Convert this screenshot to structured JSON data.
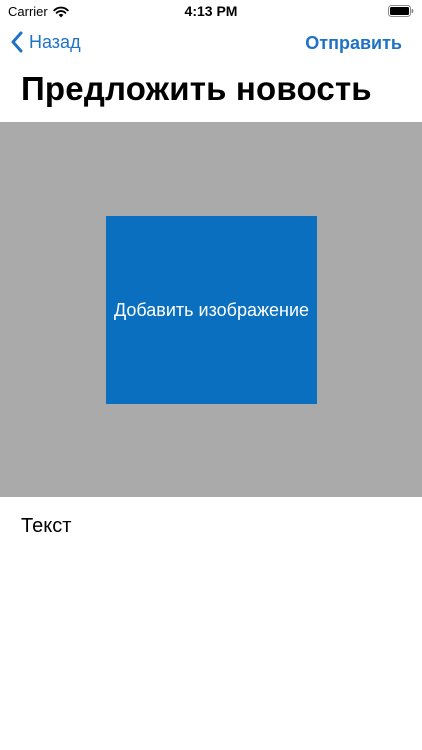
{
  "status_bar": {
    "carrier": "Carrier",
    "time": "4:13 PM",
    "wifi_icon": "wifi-icon",
    "battery_icon": "battery-icon"
  },
  "nav": {
    "back_label": "Назад",
    "back_icon": "chevron-left-icon",
    "send_label": "Отправить",
    "accent_color": "#1f72c5"
  },
  "page": {
    "title": "Предложить новость"
  },
  "image_area": {
    "background_color": "#aaaaaa",
    "add_image_label": "Добавить изображение",
    "button_color": "#0a6fbe"
  },
  "text_field": {
    "placeholder": "Текст",
    "value": ""
  }
}
